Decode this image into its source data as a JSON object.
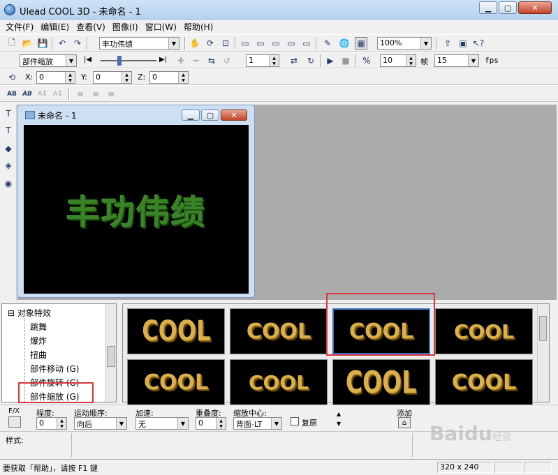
{
  "window": {
    "title": "Ulead COOL 3D - 未命名 - 1"
  },
  "menu": [
    "文件(F)",
    "编辑(E)",
    "查看(V)",
    "图像(I)",
    "窗口(W)",
    "帮助(H)"
  ],
  "toolbar1": {
    "font_text": "丰功伟绩",
    "zoom": "100%"
  },
  "toolbar2": {
    "effect": "部件缩放",
    "frame": "1",
    "frame_count": "10",
    "frames_label": "帧",
    "fps_value": "15",
    "fps_label": "fps"
  },
  "toolbar3": {
    "x_label": "X:",
    "x_value": "0",
    "y_label": "Y:",
    "y_value": "0",
    "z_label": "Z:",
    "z_value": "0"
  },
  "child_window": {
    "title": "未命名 - 1",
    "canvas_text": "丰功伟绩",
    "text_color": "#3f8f2a"
  },
  "tree": {
    "root": "对象特效",
    "items": [
      "跳舞",
      "爆炸",
      "扭曲",
      "部件移动 (G)",
      "部件旋转 (G)",
      "部件缩放 (G)"
    ]
  },
  "gallery": {
    "thumb_text": "COOL",
    "thumb_count": 8,
    "selected_index": 2
  },
  "properties": {
    "fx_label": "F/X",
    "degree_label": "程度:",
    "degree_value": "0",
    "order_label": "运动顺序:",
    "order_value": "向后",
    "accel_label": "加速:",
    "accel_value": "无",
    "overlap_label": "重叠度:",
    "overlap_value": "0",
    "center_label": "缩放中心:",
    "center_value": "背面-LT",
    "restore_label": "复原",
    "add_label": "添加"
  },
  "style_label": "样式:",
  "status": {
    "help_text": "要获取「帮助」，请按 F1 键",
    "size": "320 x 240"
  },
  "watermark": {
    "brand": "Baidu",
    "suffix": "经验"
  },
  "colors": {
    "highlight": "#d9363e",
    "canvas_bg": "#000000",
    "thumb_text": "#d9b04a"
  }
}
